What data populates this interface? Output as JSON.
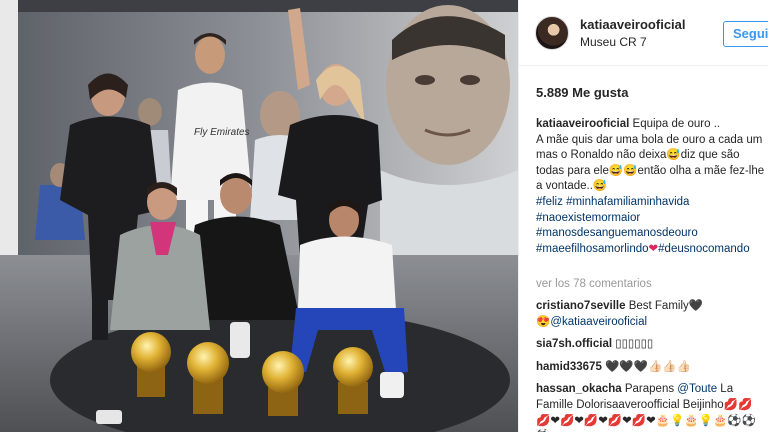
{
  "post": {
    "photo_alt": "",
    "jersey_text": "Fly Emirates"
  },
  "header": {
    "username": "katiaaveirooficial",
    "location": "Museu CR 7",
    "follow_label": "Seguir"
  },
  "likes": "5.889 Me gusta",
  "caption": {
    "username": "katiaaveirooficial",
    "text_1": " Equipa de ouro ..",
    "text_2": "A mãe quis dar uma bola de ouro a cada um mas o Ronaldo não deixa😅diz que são todas para ele😅😅então olha a mãe fez-lhe a vontade..😅",
    "hashtags": [
      "#feliz",
      "#minhafamiliaminhavida",
      "#naoexistemormaior",
      "#manosdesanguemanosdeouro",
      "#maeefilhosamorlindo",
      "#deusnocomandoᅟᅟ"
    ],
    "heart": "❤"
  },
  "view_all_comments": "ver los 78 comentarios",
  "comments": [
    {
      "username": "cristiano7seville",
      "text": " Best Family🖤",
      "mention_prefix": "😍",
      "mention": "@katiaaveirooficial",
      "mention_suffix": ""
    },
    {
      "username": "sia7sh.official",
      "text": " ▯▯▯▯▯▯",
      "mention_prefix": "",
      "mention": "",
      "mention_suffix": ""
    },
    {
      "username": "hamid33675",
      "text": " 🖤🖤🖤👍🏻👍🏻👍🏻",
      "mention_prefix": "",
      "mention": "",
      "mention_suffix": ""
    },
    {
      "username": "hassan_okacha",
      "text": " Parapens ",
      "mention_prefix": "",
      "mention": "@Toute",
      "mention_suffix": " La Famille Dolorisaaveroofficial Beijinho💋💋 💋❤💋❤💋❤💋❤💋❤🎂💡🎂💡🎂⚽⚽⚽"
    }
  ],
  "colors": {
    "link": "#003569",
    "follow": "#3897f0",
    "muted": "#999999",
    "border": "#efefef"
  }
}
